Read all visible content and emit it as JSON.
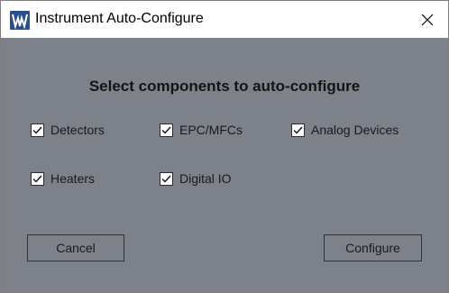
{
  "window": {
    "title": "Instrument Auto-Configure"
  },
  "dialog": {
    "heading": "Select components to auto-configure",
    "checkboxes": [
      {
        "label": "Detectors",
        "checked": true
      },
      {
        "label": "EPC/MFCs",
        "checked": true
      },
      {
        "label": "Analog Devices",
        "checked": true
      },
      {
        "label": "Heaters",
        "checked": true
      },
      {
        "label": "Digital IO",
        "checked": true
      }
    ],
    "cancel_label": "Cancel",
    "configure_label": "Configure"
  },
  "colors": {
    "dialog_background": "#7d828a",
    "app_icon": "#2c4f8c",
    "titlebar": "#ffffff"
  },
  "icons": {
    "app": "app-logo-icon",
    "close": "close-icon",
    "check": "checkmark-icon"
  }
}
